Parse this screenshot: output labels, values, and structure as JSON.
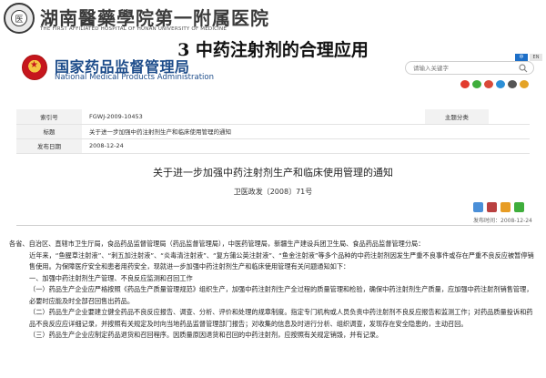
{
  "hospital": {
    "name_cn": "湖南醫藥學院第一附属医院",
    "name_en": "THE FIRST AFFILIATED HOSPITAL OF HUNAN UNIVERSITY OF MEDICINE",
    "logo_char": "医"
  },
  "slide_title": "3 中药注射剂的合理应用",
  "nmpa": {
    "name_cn": "国家药品监督管理局",
    "name_en": "National Medical Products Administration"
  },
  "search": {
    "placeholder": "请输入关键字"
  },
  "lang": {
    "cn": "中",
    "en": "EN"
  },
  "meta": {
    "index_label": "索引号",
    "index_value": "FGWJ-2009-10453",
    "category_label": "主题分类",
    "category_value": "",
    "title_label": "标题",
    "title_value": "关于进一步加强中药注射剂生产和临床使用管理的通知",
    "date_label": "发布日期",
    "date_value": "2008-12-24"
  },
  "doc": {
    "title": "关于进一步加强中药注射剂生产和临床使用管理的通知",
    "number": "卫医政发〔2008〕71号",
    "publish_date": "发布时间：2008-12-24"
  },
  "body": {
    "p1": "各省、自治区、直辖市卫生厅局，食品药品监督管理局（药品监督管理局），中医药管理局，新疆生产建设兵团卫生局、食品药品监督管理分局：",
    "p2": "近年来，“鱼腥草注射液”、“刺五加注射液”、“炎毒清注射液”、“复方蒲公英注射液”、“鱼金注射液”等多个品种的中药注射剂因发生严重不良事件或存在严重不良反应被暂停销售使用。为保障医疗安全和患者用药安全，现就进一步加强中药注射剂生产和临床使用管理有关问题通知如下：",
    "p3": "一、加强中药注射剂生产管理、不良反应监测和召回工作",
    "p4": "（一）药品生产企业应严格按照《药品生产质量管理规范》组织生产，加强中药注射剂生产全过程的质量管理和检验，确保中药注射剂生产质量，应加强中药注射剂销售管理，必要时应能及时全部召回售出药品。",
    "p5": "（二）药品生产企业要建立健全药品不良反应报告、调查、分析、评价和处理的规章制度。指定专门机构或人员负责中药注射剂不良反应报告和监测工作；对药品质量投诉和药品不良反应应详细记录，并按照有关规定及时向当地药品监督管理部门报告；对收集的信息及时进行分析、组织调查，发现存在安全隐患的，主动召回。",
    "p6": "（三）药品生产企业应制定药品退货和召回程序。因质量原因退货和召回的中药注射剂，应按照有关规定销毁，并有记录。"
  },
  "colors": {
    "nmpa_blue": "#1d4c8a",
    "emblem_red": "#c6161d"
  }
}
